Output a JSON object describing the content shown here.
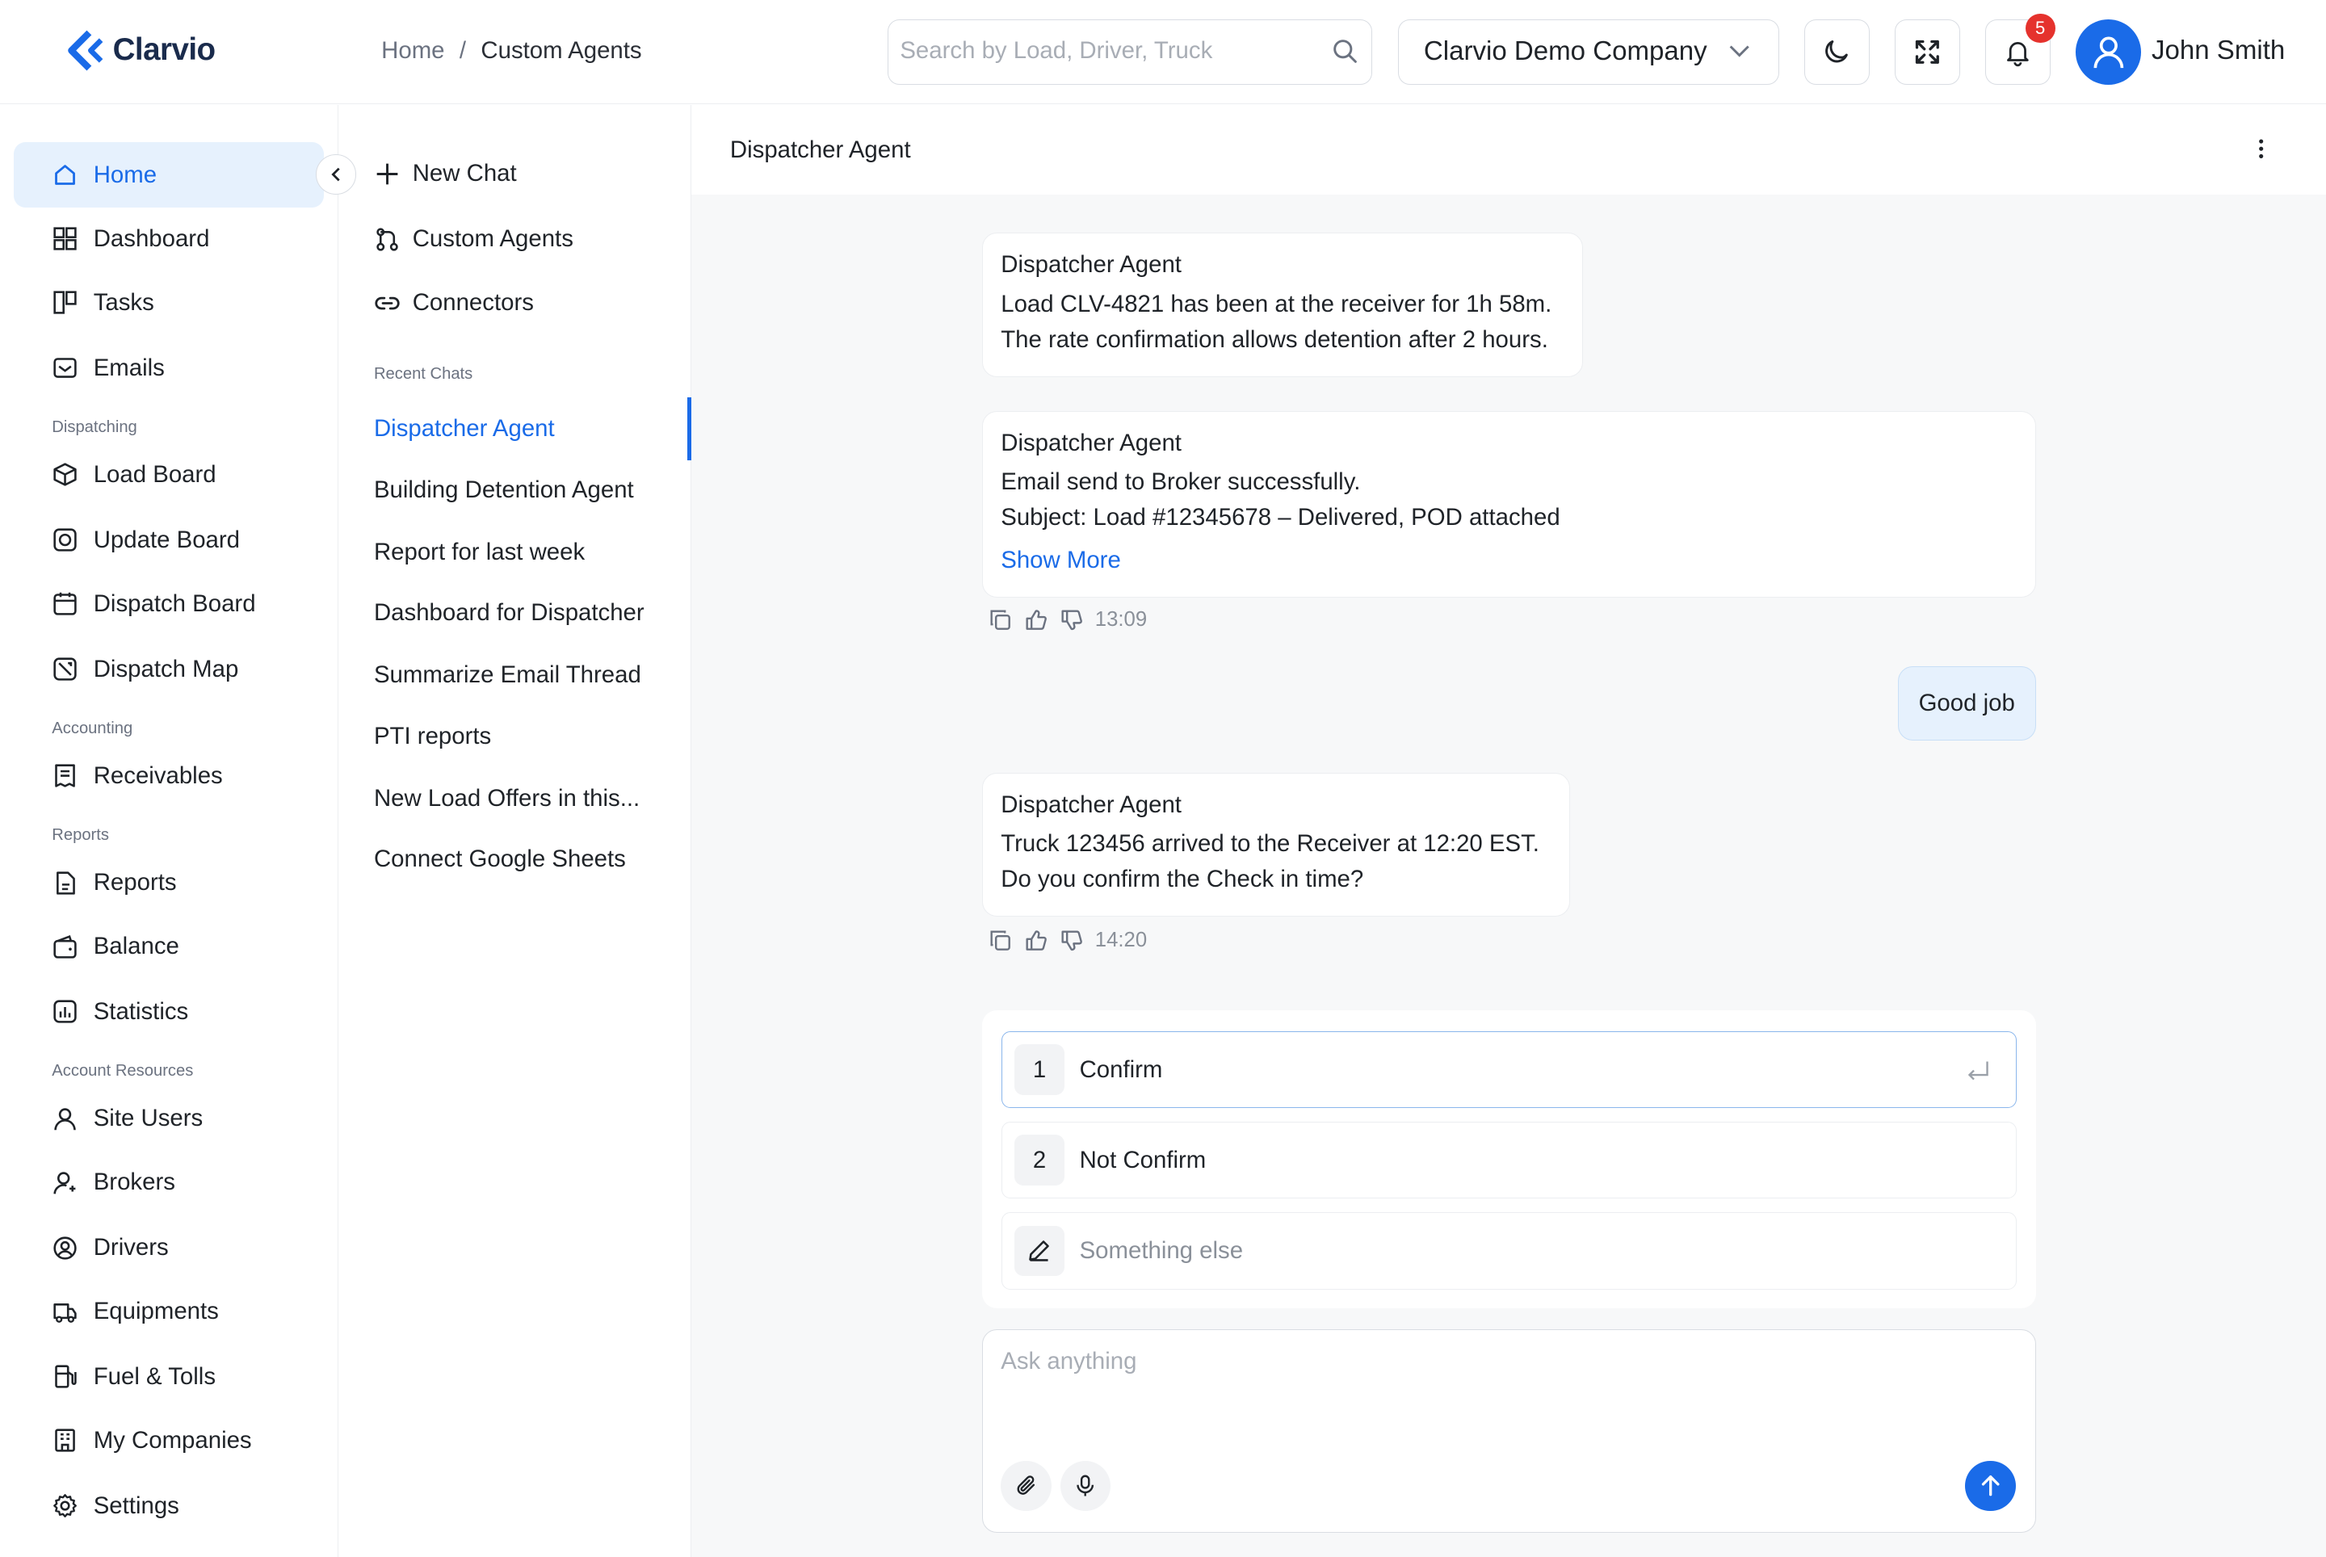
{
  "app": {
    "logo_text": "Clarvio",
    "brand_color": "#1a6be8"
  },
  "breadcrumb": {
    "home": "Home",
    "separator": "/",
    "current": "Custom Agents"
  },
  "search": {
    "placeholder": "Search by Load, Driver, Truck"
  },
  "company_select": {
    "value": "Clarvio Demo Company"
  },
  "notifications": {
    "count": "5"
  },
  "user": {
    "name": "John Smith"
  },
  "sidebar": {
    "items": [
      {
        "label": "Home",
        "icon": "home-icon",
        "active": true
      },
      {
        "label": "Dashboard",
        "icon": "dashboard-icon"
      },
      {
        "label": "Tasks",
        "icon": "tasks-icon"
      },
      {
        "label": "Emails",
        "icon": "email-icon"
      },
      {
        "label": "Load Board",
        "icon": "box-icon"
      },
      {
        "label": "Update Board",
        "icon": "update-icon"
      },
      {
        "label": "Dispatch Board",
        "icon": "calendar-icon"
      },
      {
        "label": "Dispatch Map",
        "icon": "map-icon"
      },
      {
        "label": "Receivables",
        "icon": "receipt-icon"
      },
      {
        "label": "Reports",
        "icon": "report-icon"
      },
      {
        "label": "Balance",
        "icon": "wallet-icon"
      },
      {
        "label": "Statistics",
        "icon": "chart-icon"
      },
      {
        "label": "Site Users",
        "icon": "user-icon"
      },
      {
        "label": "Brokers",
        "icon": "broker-icon"
      },
      {
        "label": "Drivers",
        "icon": "driver-icon"
      },
      {
        "label": "Equipments",
        "icon": "truck-icon"
      },
      {
        "label": "Fuel & Tolls",
        "icon": "fuel-icon"
      },
      {
        "label": "My Companies",
        "icon": "building-icon"
      },
      {
        "label": "Settings",
        "icon": "gear-icon"
      }
    ],
    "groups": [
      "Dispatching",
      "Accounting",
      "Reports",
      "Account Resources"
    ]
  },
  "agents_panel": {
    "new_chat": "New Chat",
    "custom_agents": "Custom Agents",
    "connectors": "Connectors",
    "recent_label": "Recent Chats",
    "recent": [
      "Dispatcher Agent",
      "Building Detention Agent",
      "Report for last week",
      "Dashboard for Dispatcher",
      "Summarize Email Thread",
      "PTI reports",
      "New Load Offers in this...",
      "Connect Google Sheets"
    ]
  },
  "chat": {
    "title": "Dispatcher Agent",
    "messages": [
      {
        "sender": "Dispatcher Agent",
        "lines": [
          "Load CLV-4821 has been at the receiver for 1h 58m.",
          "The rate confirmation allows detention after 2 hours."
        ]
      },
      {
        "sender": "Dispatcher Agent",
        "lines": [
          "Email send to Broker successfully.",
          "Subject: Load #12345678 – Delivered, POD attached"
        ],
        "show_more": "Show More",
        "time": "13:09"
      },
      {
        "sender": "user",
        "text": "Good job"
      },
      {
        "sender": "Dispatcher Agent",
        "lines": [
          "Truck 123456 arrived to the Receiver at 12:20 EST.",
          "Do you confirm the Check in time?"
        ],
        "time": "14:20"
      }
    ],
    "options": [
      {
        "num": "1",
        "label": "Confirm"
      },
      {
        "num": "2",
        "label": "Not Confirm"
      },
      {
        "label": "Something else"
      }
    ],
    "composer_placeholder": "Ask anything"
  }
}
